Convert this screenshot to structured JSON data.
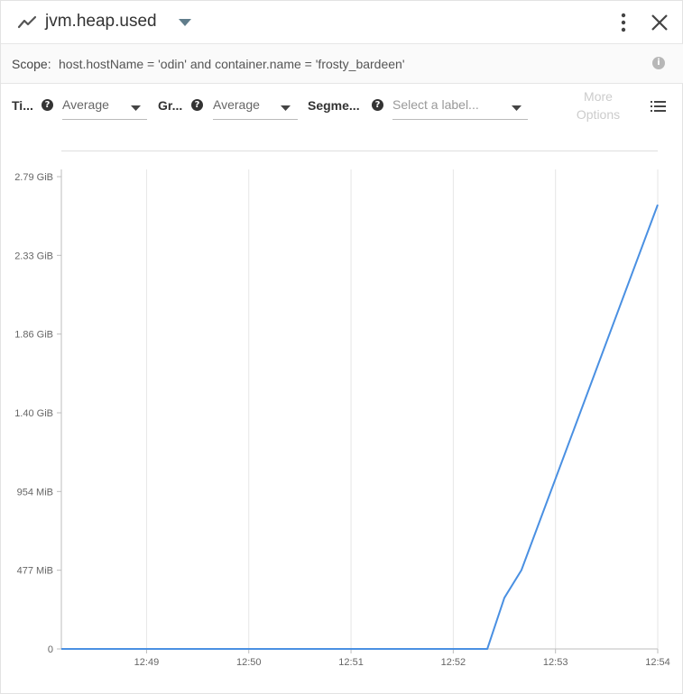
{
  "header": {
    "title": "jvm.heap.used",
    "metric_icon": "line-chart-icon",
    "menu_icon": "more-vert-icon",
    "close_icon": "close-icon"
  },
  "scope": {
    "label": "Scope:",
    "value": "host.hostName = 'odin' and container.name = 'frosty_bardeen'",
    "info_icon": "info-icon"
  },
  "options": {
    "time_label": "Ti...",
    "time_value": "Average",
    "group_label": "Gr...",
    "group_value": "Average",
    "segment_label": "Segme...",
    "segment_placeholder": "Select a label...",
    "more_options": "More Options",
    "list_icon": "list-icon",
    "help_icon": "help-icon"
  },
  "colors": {
    "line": "#4a90e2",
    "grid": "#e6e6e6",
    "axis": "#bdbdbd"
  },
  "chart_data": {
    "type": "line",
    "title": "",
    "xlabel": "",
    "ylabel": "",
    "x_ticks": [
      "12:49",
      "12:50",
      "12:51",
      "12:52",
      "12:53",
      "12:54"
    ],
    "y_ticks": [
      "0",
      "477 MiB",
      "954 MiB",
      "1.40 GiB",
      "1.86 GiB",
      "2.33 GiB",
      "2.79 GiB"
    ],
    "y_unit": "MiB",
    "xlim": [
      "12:48:10",
      "12:54:00"
    ],
    "ylim": [
      0,
      2860
    ],
    "grid": "vertical",
    "series": [
      {
        "x": [
          "12:48:10",
          "12:52:20",
          "12:52:30",
          "12:52:40",
          "12:54:00"
        ],
        "y": [
          0,
          0,
          305,
          470,
          2650
        ]
      }
    ]
  }
}
